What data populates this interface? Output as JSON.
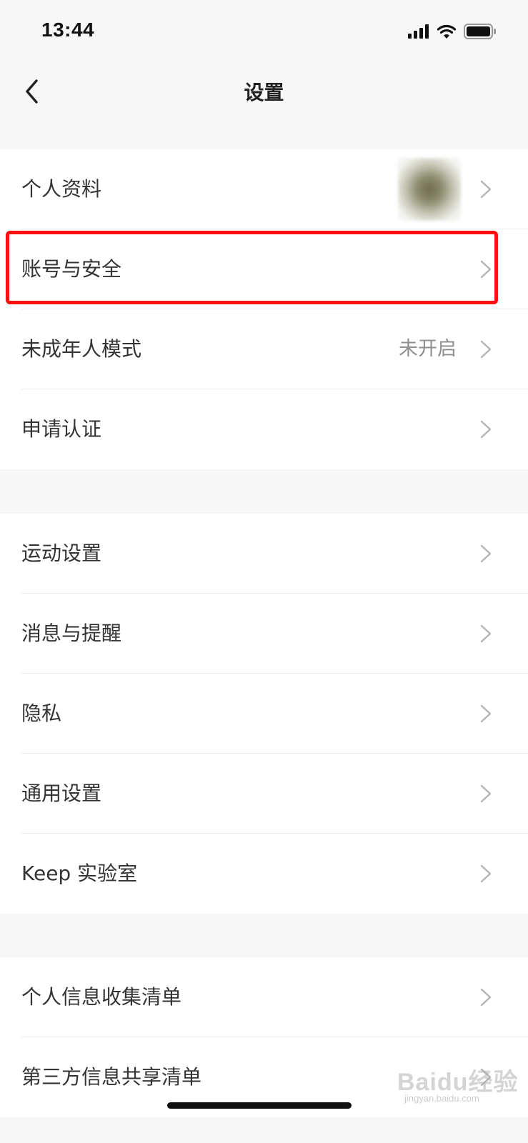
{
  "status_bar": {
    "time": "13:44",
    "icons": [
      "signal-icon",
      "wifi-icon",
      "battery-icon"
    ]
  },
  "nav": {
    "title": "设置",
    "back_icon": "chevron-left-icon"
  },
  "groups": [
    {
      "rows": [
        {
          "label": "个人资料",
          "value": "",
          "has_avatar": true
        },
        {
          "label": "账号与安全",
          "value": "",
          "highlighted": true
        },
        {
          "label": "未成年人模式",
          "value": "未开启"
        },
        {
          "label": "申请认证",
          "value": ""
        }
      ]
    },
    {
      "rows": [
        {
          "label": "运动设置",
          "value": ""
        },
        {
          "label": "消息与提醒",
          "value": ""
        },
        {
          "label": "隐私",
          "value": ""
        },
        {
          "label": "通用设置",
          "value": ""
        },
        {
          "label": "Keep 实验室",
          "value": ""
        }
      ]
    },
    {
      "rows": [
        {
          "label": "个人信息收集清单",
          "value": ""
        },
        {
          "label": "第三方信息共享清单",
          "value": ""
        }
      ]
    }
  ],
  "watermark": {
    "text": "Baidu经验",
    "sub": "jingyan.baidu.com"
  },
  "colors": {
    "background": "#f7f7f7",
    "row_background": "#ffffff",
    "label_text": "#333333",
    "value_text": "#8e8e8e",
    "chevron": "#b5b5b5",
    "highlight": "#ff1010"
  }
}
